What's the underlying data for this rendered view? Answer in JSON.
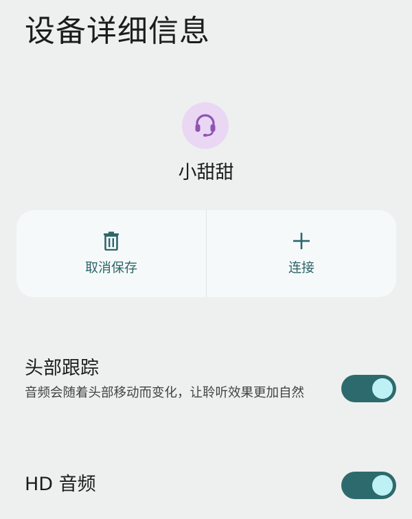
{
  "page": {
    "title": "设备详细信息"
  },
  "device": {
    "name": "小甜甜",
    "icon": "headset-icon",
    "avatar_color": "#e9d7f3",
    "icon_color": "#8e54b3"
  },
  "actions": {
    "forget_label": "取消保存",
    "forget_icon": "trash-icon",
    "connect_label": "连接",
    "connect_icon": "plus-icon",
    "accent_color": "#2c6669"
  },
  "settings": {
    "head_tracking": {
      "title": "头部跟踪",
      "description": "音频会随着头部移动而变化，让聆听效果更加自然",
      "enabled": true
    },
    "hd_audio": {
      "title": "HD 音频",
      "enabled": true
    },
    "toggle_track_color": "#2d6a6d",
    "toggle_knob_color": "#bdf1f6"
  }
}
